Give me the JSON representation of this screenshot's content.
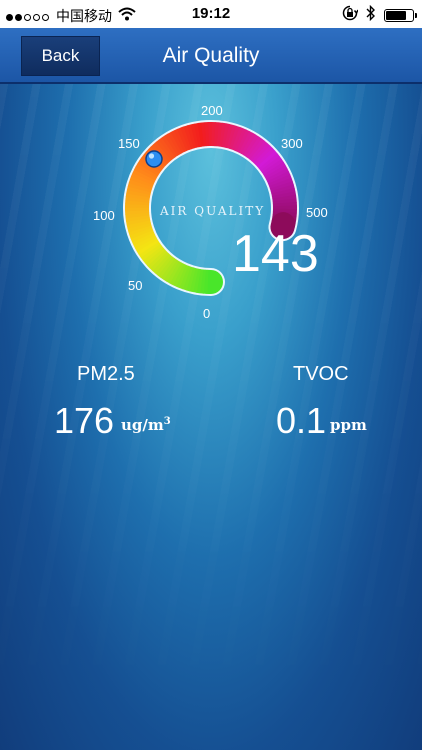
{
  "status_bar": {
    "carrier": "中国移动",
    "time": "19:12",
    "battery_level": 0.85,
    "signal_bars_filled": 2,
    "signal_bars_total": 5
  },
  "header": {
    "back_label": "Back",
    "title": "Air Quality"
  },
  "gauge": {
    "label": "AIR QUALITY",
    "value": "143",
    "ticks": [
      "0",
      "50",
      "100",
      "150",
      "200",
      "300",
      "500"
    ]
  },
  "readings": {
    "pm25": {
      "name": "PM2.5",
      "value": "176",
      "unit_base": "ug/m",
      "unit_exp": "3"
    },
    "tvoc": {
      "name": "TVOC",
      "value": "0.1",
      "unit": "ppm"
    }
  },
  "colors": {
    "nav_background": "#2363b4",
    "back_button": "#12336a",
    "gauge_colors": [
      "#49e62a",
      "#f4e513",
      "#ff8a1a",
      "#f21d1d",
      "#d21ad6",
      "#8a0a56"
    ],
    "indicator": "#2d8ef2"
  }
}
